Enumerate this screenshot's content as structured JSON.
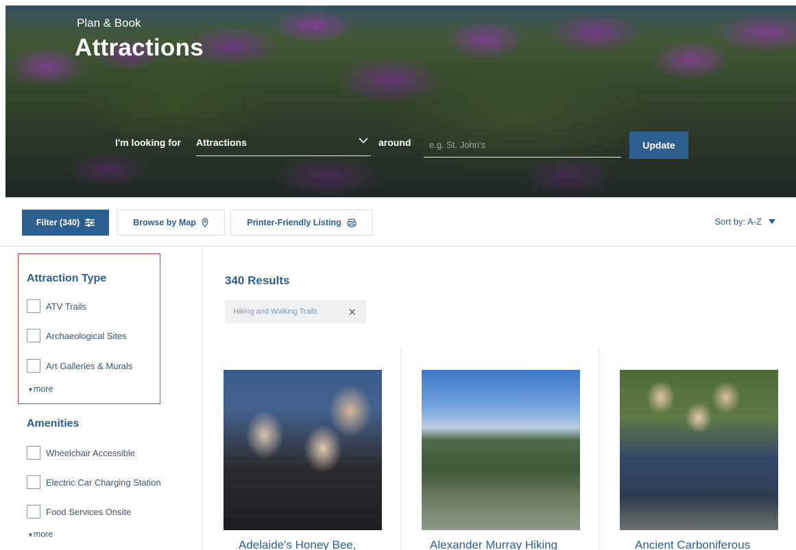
{
  "hero": {
    "eyebrow": "Plan & Book",
    "title": "Attractions",
    "search": {
      "looking_label": "I'm looking for",
      "type_value": "Attractions",
      "around_label": "around",
      "location_placeholder": "e.g. St. John's",
      "update_label": "Update"
    }
  },
  "toolbar": {
    "filter_label": "Filter (340)",
    "browse_map_label": "Browse by Map",
    "printer_label": "Printer-Friendly Listing",
    "sort_label": "Sort by: A-Z"
  },
  "sidebar": {
    "groups": [
      {
        "title": "Attraction Type",
        "items": [
          "ATV Trails",
          "Archaeological Sites",
          "Art Galleries & Murals"
        ],
        "more_label": "more"
      },
      {
        "title": "Amenities",
        "items": [
          "Wheelchair Accessible",
          "Electric Car Charging Station",
          "Food Services Onsite"
        ],
        "more_label": "more"
      }
    ]
  },
  "results": {
    "count_label": "340 Results",
    "active_filter": "Hiking and Walking Trails",
    "cards": [
      {
        "title": "Adelaide's Honey Bee,"
      },
      {
        "title": "Alexander Murray Hiking"
      },
      {
        "title": "Ancient Carboniferous"
      }
    ]
  },
  "colors": {
    "accent": "#2d5f8e",
    "highlight_border": "#d9343a"
  }
}
